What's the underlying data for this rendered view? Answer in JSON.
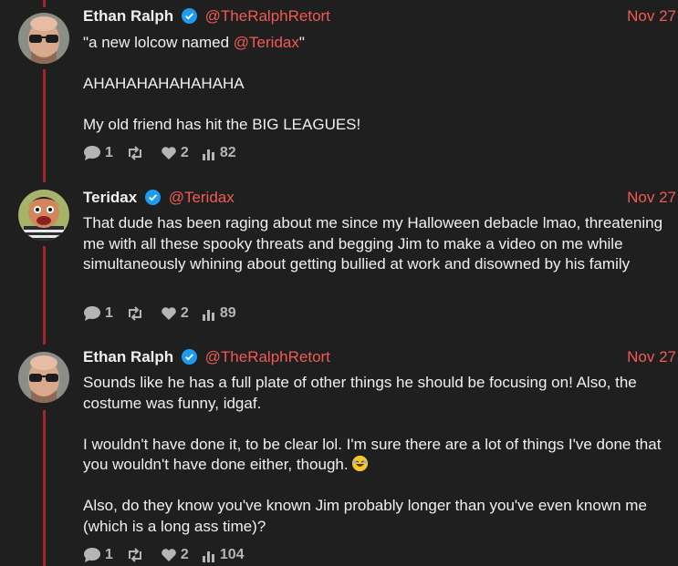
{
  "posts": [
    {
      "name": "Ethan Ralph",
      "handle": "@TheRalphRetort",
      "date": "Nov 27",
      "avatar": "bald-man-sunglasses-avatar",
      "quote_open": "\"a new lolcow named ",
      "quote_mention": "@Teridax",
      "quote_close": "\"",
      "line2": "AHAHAHAHAHAHAHA",
      "line3": "My old friend has hit the BIG LEAGUES!",
      "replies": "1",
      "likes": "2",
      "views": "82"
    },
    {
      "name": "Teridax",
      "handle": "@Teridax",
      "date": "Nov 27",
      "avatar": "puppet-avatar",
      "text": "That dude has been raging about me since my Halloween debacle lmao, threatening me with all these spooky threats and begging Jim to make a video on me while simultaneously whining about getting bullied at work and disowned by his family",
      "replies": "1",
      "likes": "2",
      "views": "89"
    },
    {
      "name": "Ethan Ralph",
      "handle": "@TheRalphRetort",
      "date": "Nov 27",
      "avatar": "bald-man-sunglasses-avatar",
      "para1": "Sounds like he has a full plate of other things he should be focusing on! Also, the costume was funny, idgaf.",
      "para2": "I wouldn't have done it, to be clear lol. I'm sure there are a lot of things I've done that you wouldn't have done either, though.",
      "para2_emoji": "laughing-emoji",
      "para3": "Also, do they know you've known Jim probably longer than you've even known me (which is a long ass time)?",
      "replies": "1",
      "likes": "2",
      "views": "104"
    }
  ],
  "colors": {
    "background": "#1f1f1f",
    "accent": "#f15a55",
    "thread_line": "#a5252f",
    "verified": "#1d9bf0"
  }
}
